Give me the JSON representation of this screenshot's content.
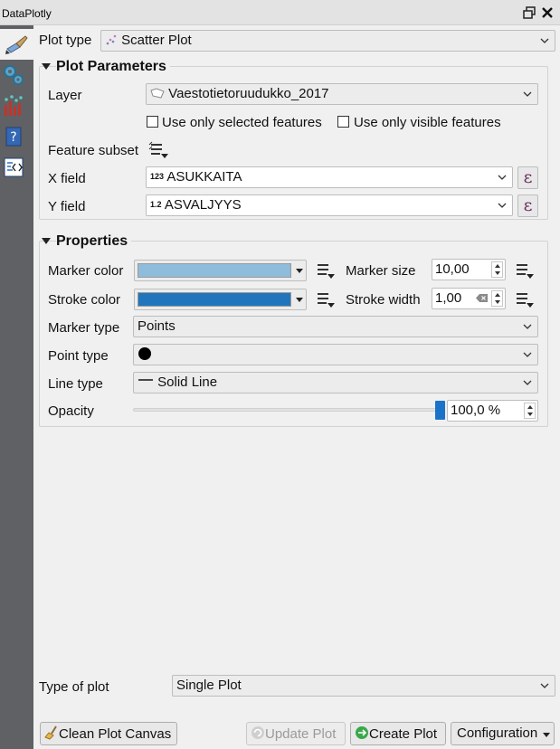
{
  "window": {
    "title": "DataPlotly"
  },
  "plot_type": {
    "label": "Plot type",
    "value": "Scatter Plot"
  },
  "plot_parameters": {
    "title": "Plot Parameters",
    "layer_label": "Layer",
    "layer_value": "Vaestotietoruudukko_2017",
    "use_selected_label": "Use only selected features",
    "use_visible_label": "Use only visible features",
    "feature_subset_label": "Feature subset",
    "x_field_label": "X field",
    "x_field_type": "123",
    "x_field_value": "ASUKKAITA",
    "y_field_label": "Y field",
    "y_field_type": "1.2",
    "y_field_value": "ASVALJYYS",
    "expression_symbol": "ε"
  },
  "properties": {
    "title": "Properties",
    "marker_color_label": "Marker color",
    "marker_color": "#8fbcdb",
    "marker_size_label": "Marker size",
    "marker_size_value": "10,00",
    "stroke_color_label": "Stroke color",
    "stroke_color": "#2176bb",
    "stroke_width_label": "Stroke width",
    "stroke_width_value": "1,00",
    "marker_type_label": "Marker type",
    "marker_type_value": "Points",
    "point_type_label": "Point type",
    "line_type_label": "Line type",
    "line_type_value": "Solid Line",
    "opacity_label": "Opacity",
    "opacity_value": "100,0 %",
    "opacity_level": 1.0
  },
  "bottom": {
    "type_of_plot_label": "Type of plot",
    "type_of_plot_value": "Single Plot",
    "clean_label": "Clean Plot Canvas",
    "update_label": "Update Plot",
    "create_label": "Create Plot",
    "config_label": "Configuration"
  }
}
